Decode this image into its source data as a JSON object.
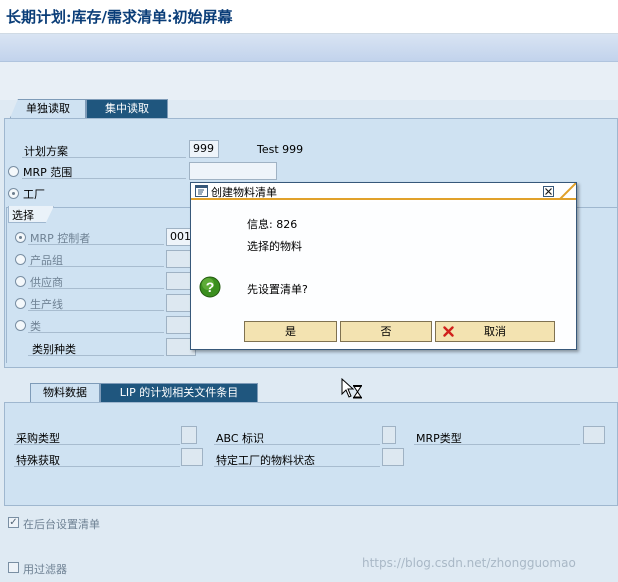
{
  "window": {
    "title": "长期计划:库存/需求清单:初始屏幕"
  },
  "tabs_upper": [
    {
      "label": "单独读取"
    },
    {
      "label": "集中读取"
    }
  ],
  "planning": {
    "scenario_label": "计划方案",
    "scenario_value": "999",
    "scenario_text": "Test 999",
    "mrp_area_label": "MRP 范围",
    "plant_label": "工厂"
  },
  "selection": {
    "section_label": "选择",
    "options": [
      {
        "label": "MRP 控制者",
        "value": "001"
      },
      {
        "label": "产品组",
        "value": ""
      },
      {
        "label": "供应商",
        "value": ""
      },
      {
        "label": "生产线",
        "value": ""
      },
      {
        "label": "类",
        "value": ""
      }
    ],
    "class_type_label": "类别种类"
  },
  "tabs_lower": [
    {
      "label": "物料数据"
    },
    {
      "label": "LIP 的计划相关文件条目"
    }
  ],
  "material_fields": [
    {
      "label": "采购类型"
    },
    {
      "label": "ABC 标识"
    },
    {
      "label": "MRP类型"
    },
    {
      "label": "特殊获取"
    },
    {
      "label": "特定工厂的物料状态"
    }
  ],
  "background": {
    "label": "在后台设置清单",
    "checked": true
  },
  "filter": {
    "label": "用过滤器",
    "checked": false
  },
  "dialog": {
    "title": "创建物料清单",
    "info_line": "信息: 826",
    "selected_line": "选择的物料",
    "question": "先设置清单?",
    "yes_label": "是",
    "no_label": "否",
    "cancel_label": "取消"
  },
  "watermark": "https://blog.csdn.net/zhongguomao",
  "colors": {
    "tab_dark": "#1f567e",
    "panel": "#cfe2f2",
    "dialog_border": "#37587a",
    "button": "#f3e3b1",
    "title": "#0a3d78"
  }
}
